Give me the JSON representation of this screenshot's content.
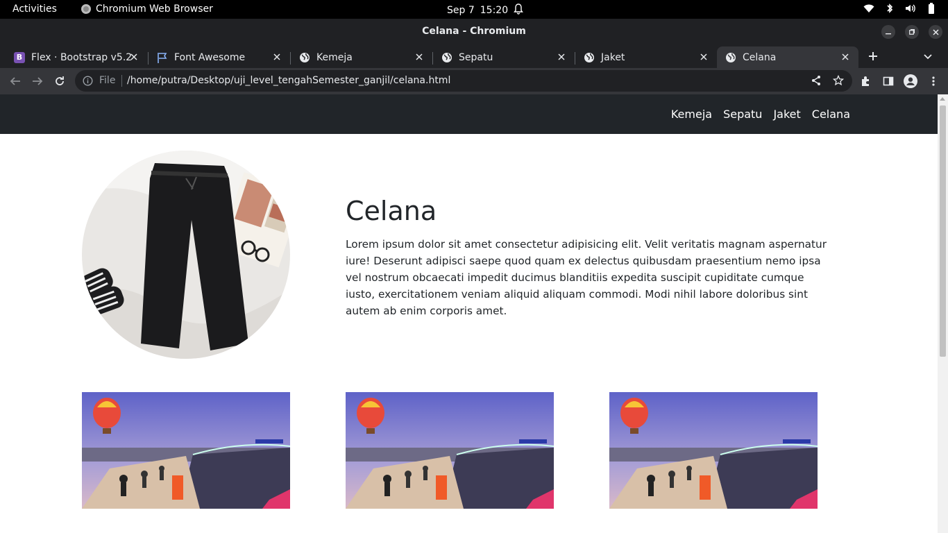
{
  "system_bar": {
    "activities": "Activities",
    "app_name": "Chromium Web Browser",
    "date": "Sep 7",
    "time": "15:20"
  },
  "window": {
    "title": "Celana - Chromium"
  },
  "tabs": [
    {
      "label": "Flex · Bootstrap v5.2",
      "icon": "bootstrap-icon"
    },
    {
      "label": "Font Awesome",
      "icon": "flag-icon"
    },
    {
      "label": "Kemeja",
      "icon": "globe-icon"
    },
    {
      "label": "Sepatu",
      "icon": "globe-icon"
    },
    {
      "label": "Jaket",
      "icon": "globe-icon"
    },
    {
      "label": "Celana",
      "icon": "globe-icon",
      "active": true
    }
  ],
  "omnibox": {
    "scheme_label": "File",
    "url": "/home/putra/Desktop/uji_level_tengahSemester_ganjil/celana.html"
  },
  "site": {
    "nav": [
      "Kemeja",
      "Sepatu",
      "Jaket",
      "Celana"
    ],
    "hero_title": "Celana",
    "hero_text": "Lorem ipsum dolor sit amet consectetur adipisicing elit. Velit veritatis magnam aspernatur iure! Deserunt adipisci saepe quod quam ex delectus quibusdam praesentium nemo ipsa vel nostrum obcaecati impedit ducimus blanditiis expedita suscipit cupiditate cumque iusto, exercitationem veniam aliquid aliquam commodi. Modi nihil labore doloribus sint autem ab enim corporis amet."
  },
  "colors": {
    "navbar": "#212529",
    "browser_dark": "#202124",
    "toolbar": "#35363a",
    "text": "#212529"
  }
}
